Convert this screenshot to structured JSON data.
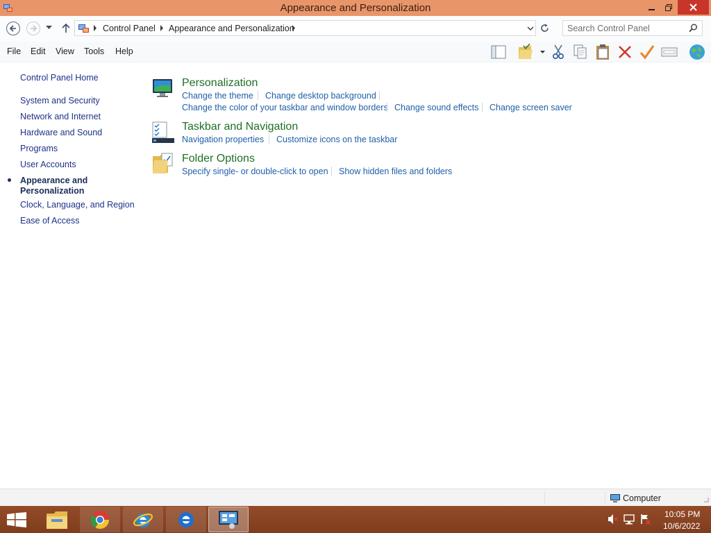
{
  "window": {
    "title": "Appearance and Personalization"
  },
  "address": {
    "crumbs": [
      "Control Panel",
      "Appearance and Personalization"
    ],
    "search_placeholder": "Search Control Panel"
  },
  "menu": {
    "items": [
      "File",
      "Edit",
      "View",
      "Tools",
      "Help"
    ]
  },
  "toolbar": {
    "icons": [
      "layout-pane-icon",
      "folder-check-icon",
      "cut-icon",
      "copy-icon",
      "paste-icon",
      "delete-icon",
      "checkmark-icon",
      "properties-icon",
      "globe-icon"
    ]
  },
  "sidebar": {
    "home": "Control Panel Home",
    "items": [
      {
        "label": "System and Security"
      },
      {
        "label": "Network and Internet"
      },
      {
        "label": "Hardware and Sound"
      },
      {
        "label": "Programs"
      },
      {
        "label": "User Accounts"
      },
      {
        "label_line1": "Appearance and",
        "label_line2": "Personalization",
        "active": true
      },
      {
        "label": "Clock, Language, and Region"
      },
      {
        "label": "Ease of Access"
      }
    ]
  },
  "categories": [
    {
      "title": "Personalization",
      "icon": "personalization-icon",
      "tasks": [
        "Change the theme",
        "Change desktop background",
        "Change the color of your taskbar and window borders",
        "Change sound effects",
        "Change screen saver"
      ]
    },
    {
      "title": "Taskbar and Navigation",
      "icon": "taskbar-icon",
      "tasks": [
        "Navigation properties",
        "Customize icons on the taskbar"
      ]
    },
    {
      "title": "Folder Options",
      "icon": "folder-options-icon",
      "tasks": [
        "Specify single- or double-click to open",
        "Show hidden files and folders"
      ]
    }
  ],
  "statusbar": {
    "location": "Computer"
  },
  "taskbar": {
    "apps": [
      "file-explorer-icon",
      "chrome-icon",
      "internet-explorer-icon",
      "internet-explorer-icon",
      "control-panel-icon"
    ],
    "time": "10:05 PM",
    "date": "10/6/2022"
  },
  "colors": {
    "titlebar": "#e9956a",
    "taskbar": "#8a4322",
    "link": "#1f5fa8",
    "category_title": "#1f6f25",
    "close_button": "#c9352b"
  }
}
